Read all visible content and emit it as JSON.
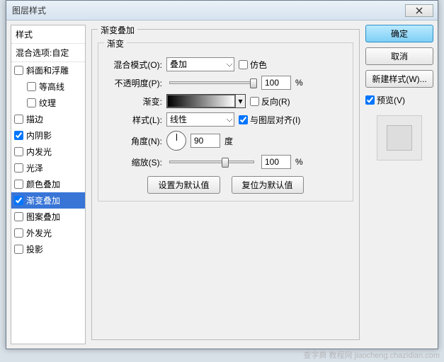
{
  "title": "图层样式",
  "sidebar": {
    "header": "样式",
    "subheader": "混合选项:自定",
    "items": [
      {
        "label": "斜面和浮雕",
        "checked": false,
        "indent": false
      },
      {
        "label": "等高线",
        "checked": false,
        "indent": true
      },
      {
        "label": "纹理",
        "checked": false,
        "indent": true
      },
      {
        "label": "描边",
        "checked": false,
        "indent": false
      },
      {
        "label": "内阴影",
        "checked": true,
        "indent": false
      },
      {
        "label": "内发光",
        "checked": false,
        "indent": false
      },
      {
        "label": "光泽",
        "checked": false,
        "indent": false
      },
      {
        "label": "颜色叠加",
        "checked": false,
        "indent": false
      },
      {
        "label": "渐变叠加",
        "checked": true,
        "indent": false,
        "selected": true
      },
      {
        "label": "图案叠加",
        "checked": false,
        "indent": false
      },
      {
        "label": "外发光",
        "checked": false,
        "indent": false
      },
      {
        "label": "投影",
        "checked": false,
        "indent": false
      }
    ]
  },
  "main": {
    "group_title": "渐变叠加",
    "inner_title": "渐变",
    "labels": {
      "blend": "混合模式(O):",
      "opacity": "不透明度(P):",
      "gradient": "渐变:",
      "style": "样式(L):",
      "angle": "角度(N):",
      "scale": "缩放(S):",
      "dither": "仿色",
      "reverse": "反向(R)",
      "align": "与图层对齐(I)",
      "degree": "度",
      "percent": "%"
    },
    "values": {
      "blend_mode": "叠加",
      "opacity": "100",
      "style": "线性",
      "angle": "90",
      "scale": "100",
      "dither": false,
      "reverse": false,
      "align": true
    },
    "buttons": {
      "default": "设置为默认值",
      "reset": "复位为默认值"
    }
  },
  "right": {
    "ok": "确定",
    "cancel": "取消",
    "new_style": "新建样式(W)...",
    "preview": "预览(V)",
    "preview_checked": true
  },
  "watermark": "查字典 教程网 jiaocheng.chazidian.com"
}
